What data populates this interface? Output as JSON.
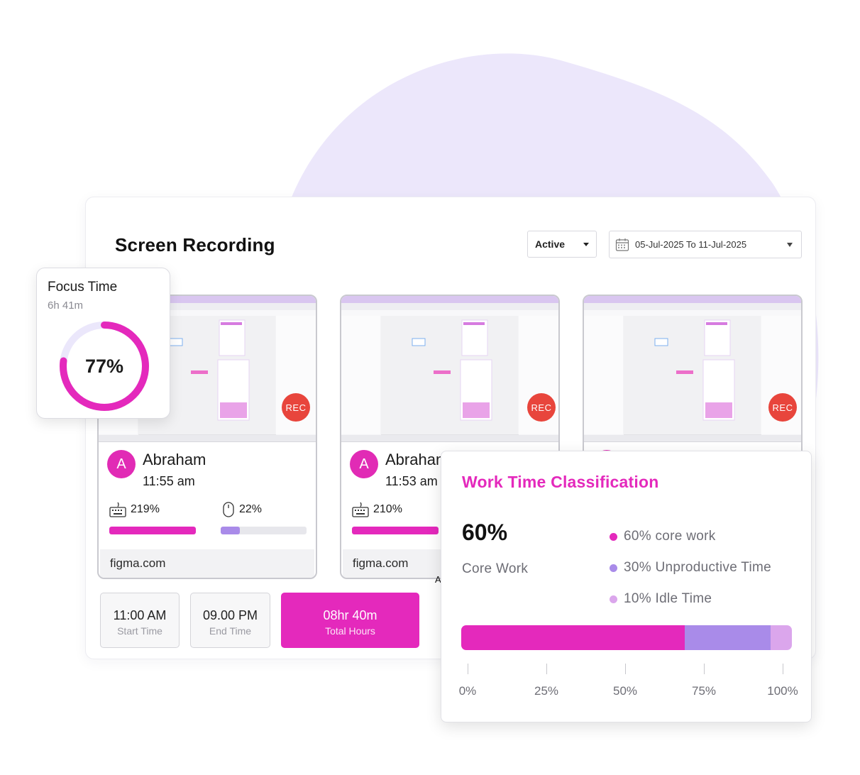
{
  "page": {
    "title": "Screen Recording",
    "status_filter": "Active",
    "date_range": "05-Jul-2025 To 11-Jul-2025"
  },
  "colors": {
    "accent": "#e429bc",
    "unproductive": "#a98be9",
    "idle": "#dba6ec",
    "rec": "#e8453c",
    "blob": "#ece7fb"
  },
  "focus": {
    "title": "Focus Time",
    "duration": "6h 41m",
    "percent_label": "77%",
    "percent": 0.77
  },
  "recordings": [
    {
      "rec_label": "REC",
      "avatar": "A",
      "name": "Abraham",
      "time": "11:55 am",
      "keyboard_label": "219%",
      "keyboard_fill": 1.0,
      "mouse_label": "22%",
      "mouse_fill": 0.22,
      "site": "figma.com"
    },
    {
      "rec_label": "REC",
      "avatar": "A",
      "name": "Abraham",
      "time": "11:53 am",
      "keyboard_label": "210%",
      "keyboard_fill": 1.0,
      "site": "figma.com"
    },
    {
      "rec_label": "REC"
    }
  ],
  "partial_text": "A",
  "time_summary": {
    "start_value": "11:00 AM",
    "start_label": "Start Time",
    "end_value": "09.00 PM",
    "end_label": "End Time",
    "total_value": "08hr 40m",
    "total_label": "Total Hours"
  },
  "classification": {
    "title": "Work Time Classification",
    "big_value": "60%",
    "big_label": "Core Work",
    "legend": [
      {
        "label": "60% core work",
        "color": "#e429bc"
      },
      {
        "label": "30% Unproductive Time",
        "color": "#a98be9"
      },
      {
        "label": "10% Idle Time",
        "color": "#dba6ec"
      }
    ],
    "segments": [
      {
        "name": "core work",
        "fraction": 0.675,
        "color": "#e429bc"
      },
      {
        "name": "unproductive",
        "fraction": 0.26,
        "color": "#a98be9"
      },
      {
        "name": "idle",
        "fraction": 0.065,
        "color": "#dba6ec"
      }
    ],
    "axis_ticks": [
      "0%",
      "25%",
      "50%",
      "75%",
      "100%"
    ]
  }
}
